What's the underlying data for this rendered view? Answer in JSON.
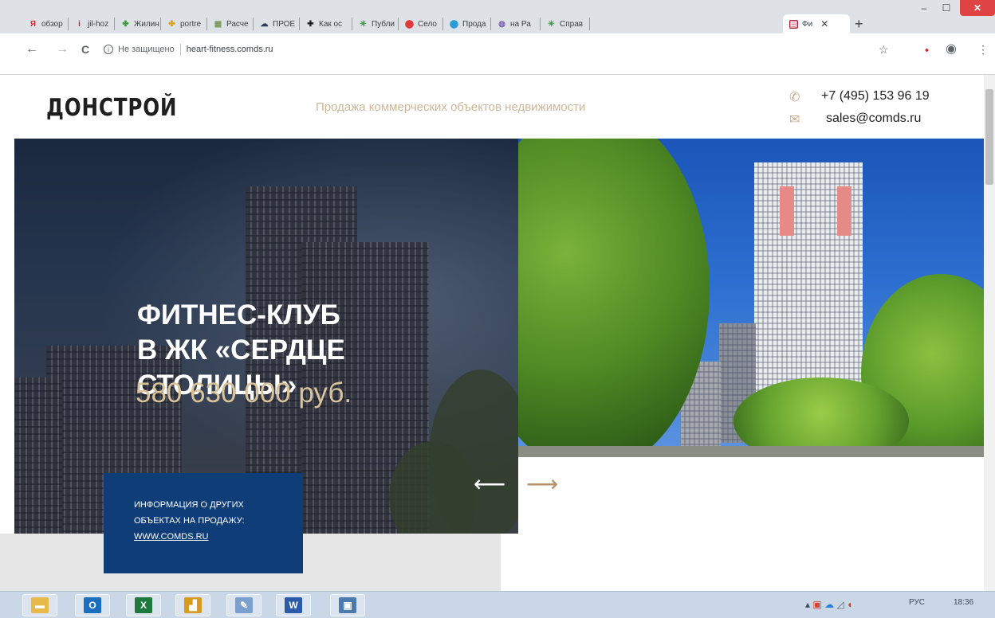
{
  "browser": {
    "tabs": [
      {
        "icon": "yandex-icon",
        "label": "обзор",
        "icon_char": "Я",
        "icon_color": "#e02020"
      },
      {
        "icon": "info-icon",
        "label": "jil-hoz",
        "icon_char": "i",
        "icon_color": "#d02020"
      },
      {
        "icon": "leaf-icon",
        "label": "Жилин",
        "icon_char": "✤",
        "icon_color": "#3a9a3a"
      },
      {
        "icon": "leaf-icon",
        "label": "portre",
        "icon_char": "✤",
        "icon_color": "#d4a020"
      },
      {
        "icon": "sheet-icon",
        "label": "Расче",
        "icon_char": "▦",
        "icon_color": "#7a9a5a"
      },
      {
        "icon": "cloud-icon",
        "label": "ПРОЕ",
        "icon_char": "☁",
        "icon_color": "#303a60"
      },
      {
        "icon": "plus-icon",
        "label": "Как ос",
        "icon_char": "✚",
        "icon_color": "#202020"
      },
      {
        "icon": "sparkle-icon",
        "label": "Публи",
        "icon_char": "✳",
        "icon_color": "#3a9a3a"
      },
      {
        "icon": "map-pin-icon",
        "label": "Село",
        "icon_char": "⬤",
        "icon_color": "#e03a3a"
      },
      {
        "icon": "map-pin-icon",
        "label": "Прода",
        "icon_char": "⬤",
        "icon_color": "#2a9ad8"
      },
      {
        "icon": "globe-icon",
        "label": "на Ра",
        "icon_char": "◍",
        "icon_color": "#7a5ab0"
      },
      {
        "icon": "sparkle-icon",
        "label": "Справ",
        "icon_char": "✳",
        "icon_color": "#3a9a3a"
      }
    ],
    "active_tab": {
      "label": "Фи",
      "icon_char": "▤",
      "icon_color": "#b0243a",
      "close": "✕"
    },
    "new_tab": "+",
    "window_controls": {
      "minimize": "‒",
      "maximize": "☐",
      "close": "✕"
    },
    "nav": {
      "back": "←",
      "forward": "→",
      "reload": "C"
    },
    "address": {
      "info": "i",
      "security_text": "Не защищено",
      "url": "heart-fitness.comds.ru"
    },
    "toolbar_icons": {
      "star": "☆",
      "extension": "⬩",
      "profile": "◉",
      "menu": "⋮"
    }
  },
  "site": {
    "logo": "ДОНСТРОЙ",
    "tagline": "Продажа коммерческих объектов недвижимости",
    "phone": "+7 (495) 153 96 19",
    "email": "sales@comds.ru",
    "phone_icon": "✆",
    "email_icon": "✉",
    "hero": {
      "title_line1": "ФИТНЕС-КЛУБ",
      "title_line2": "В ЖК «СЕРДЦЕ",
      "title_line3": "СТОЛИЦЫ»",
      "price": "580 630 000 руб.",
      "info_line1": "ИНФОРМАЦИЯ О ДРУГИХ",
      "info_line2": "ОБЪЕКТАХ НА ПРОДАЖУ:",
      "info_link": "WWW.COMDS.RU",
      "prev_arrow": "⟵",
      "next_arrow": "⟶"
    }
  },
  "taskbar": {
    "apps": [
      {
        "name": "explorer",
        "icon_char": "▬",
        "color": "#e8b84a"
      },
      {
        "name": "outlook",
        "icon_char": "O",
        "color": "#1a6fc0"
      },
      {
        "name": "excel",
        "icon_char": "X",
        "color": "#1e7a3c"
      },
      {
        "name": "charts",
        "icon_char": "▟",
        "color": "#d89a20"
      },
      {
        "name": "paint",
        "icon_char": "✎",
        "color": "#7aa0d0"
      },
      {
        "name": "word",
        "icon_char": "W",
        "color": "#2a5aa8"
      },
      {
        "name": "photos",
        "icon_char": "▣",
        "color": "#4a7ab0"
      }
    ],
    "tray": {
      "lang": "РУС",
      "time": "18:36"
    }
  },
  "colors": {
    "accent_beige": "#cdb69a",
    "price_gold": "#d9c39a",
    "info_navy": "#0f3d78",
    "arrow_brown": "#b8906c"
  }
}
